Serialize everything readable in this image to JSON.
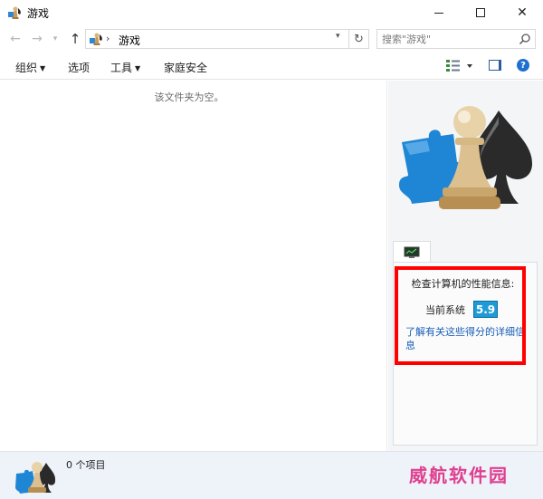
{
  "window": {
    "title": "游戏"
  },
  "nav": {
    "location": "游戏",
    "search_placeholder": "搜索\"游戏\""
  },
  "toolbar": {
    "organize": "组织",
    "options": "选项",
    "tools": "工具",
    "family_safety": "家庭安全"
  },
  "content": {
    "empty_message": "该文件夹为空。"
  },
  "performance": {
    "title": "检查计算机的性能信息:",
    "current_system_label": "当前系统",
    "score": "5.9",
    "learn_more_link": "了解有关这些得分的详细信息",
    "score_color": "#1e9bd7"
  },
  "details": {
    "item_count": "0 个项目"
  },
  "watermark": {
    "text": "威航软件园",
    "color": "#e0408f"
  },
  "colors": {
    "highlight": "#ff0000",
    "link": "#1a5fb4"
  }
}
